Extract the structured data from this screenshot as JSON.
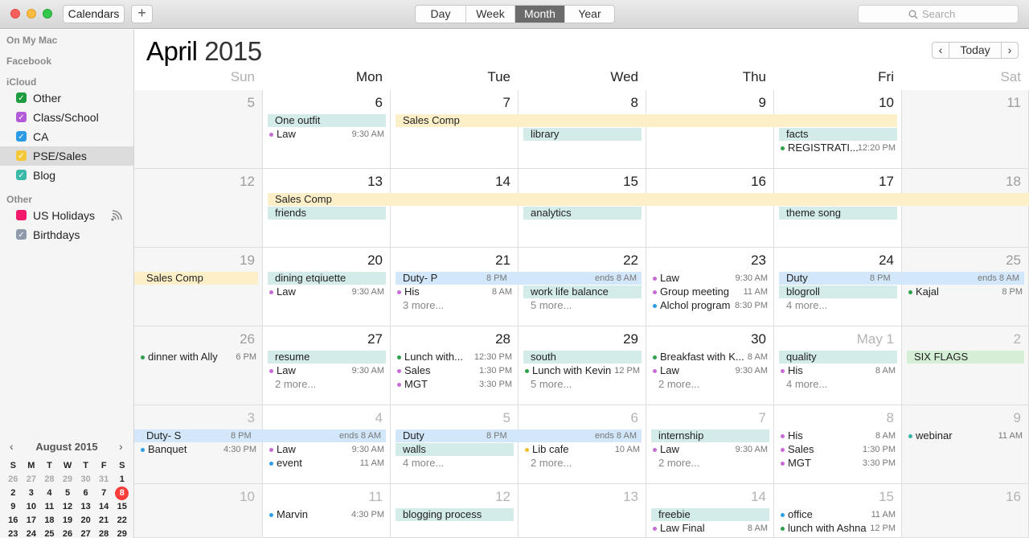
{
  "window": {
    "calendars_label": "Calendars",
    "add_label": "+",
    "views": [
      "Day",
      "Week",
      "Month",
      "Year"
    ],
    "active_view": "Month",
    "search_placeholder": "Search"
  },
  "sidebar": {
    "sections": [
      {
        "title": "On My Mac",
        "items": []
      },
      {
        "title": "Facebook",
        "items": []
      },
      {
        "title": "iCloud",
        "items": [
          {
            "label": "Other",
            "color": "#1f9c3f",
            "checked": true
          },
          {
            "label": "Class/School",
            "color": "#b25ad8",
            "checked": true
          },
          {
            "label": "CA",
            "color": "#2d9ae6",
            "checked": true
          },
          {
            "label": "PSE/Sales",
            "color": "#f5c636",
            "checked": true,
            "selected": true
          },
          {
            "label": "Blog",
            "color": "#3ab8a8",
            "checked": true
          }
        ]
      },
      {
        "title": "Other",
        "items": [
          {
            "label": "US Holidays",
            "color": "#f2186a",
            "checked": false,
            "broadcast": true
          },
          {
            "label": "Birthdays",
            "color": "#8c9aaa",
            "checked": true
          }
        ]
      }
    ],
    "minical": {
      "title": "August 2015",
      "prev": "‹",
      "next": "›",
      "weekdays": [
        "S",
        "M",
        "T",
        "W",
        "T",
        "F",
        "S"
      ],
      "rows": [
        [
          "26",
          "27",
          "28",
          "29",
          "30",
          "31",
          "1"
        ],
        [
          "2",
          "3",
          "4",
          "5",
          "6",
          "7",
          "8"
        ],
        [
          "9",
          "10",
          "11",
          "12",
          "13",
          "14",
          "15"
        ],
        [
          "16",
          "17",
          "18",
          "19",
          "20",
          "21",
          "22"
        ],
        [
          "23",
          "24",
          "25",
          "26",
          "27",
          "28",
          "29"
        ]
      ],
      "today": "8"
    }
  },
  "main": {
    "month": "April",
    "year": "2015",
    "today_label": "Today",
    "prev": "‹",
    "next": "›",
    "weekdays": [
      "Sun",
      "Mon",
      "Tue",
      "Wed",
      "Thu",
      "Fri",
      "Sat"
    ],
    "weeks": [
      [
        "5",
        "6",
        "7",
        "8",
        "9",
        "10",
        "11"
      ],
      [
        "12",
        "13",
        "14",
        "15",
        "16",
        "17",
        "18"
      ],
      [
        "19",
        "20",
        "21",
        "22",
        "23",
        "24",
        "25"
      ],
      [
        "26",
        "27",
        "28",
        "29",
        "30",
        "May 1",
        "2"
      ],
      [
        "3",
        "4",
        "5",
        "6",
        "7",
        "8",
        "9"
      ],
      [
        "10",
        "11",
        "12",
        "13",
        "14",
        "15",
        "16"
      ]
    ],
    "colors": {
      "teal_bg": "#d3ece9",
      "yellow_bg": "#fdf0c8",
      "blue_bg": "#d2e8fa",
      "green_bg": "#d4efd6",
      "purple": "#c86bd6",
      "green": "#2ea04b",
      "blue": "#2e9de6",
      "yellow": "#f0c030",
      "teal": "#36b4a6"
    }
  }
}
